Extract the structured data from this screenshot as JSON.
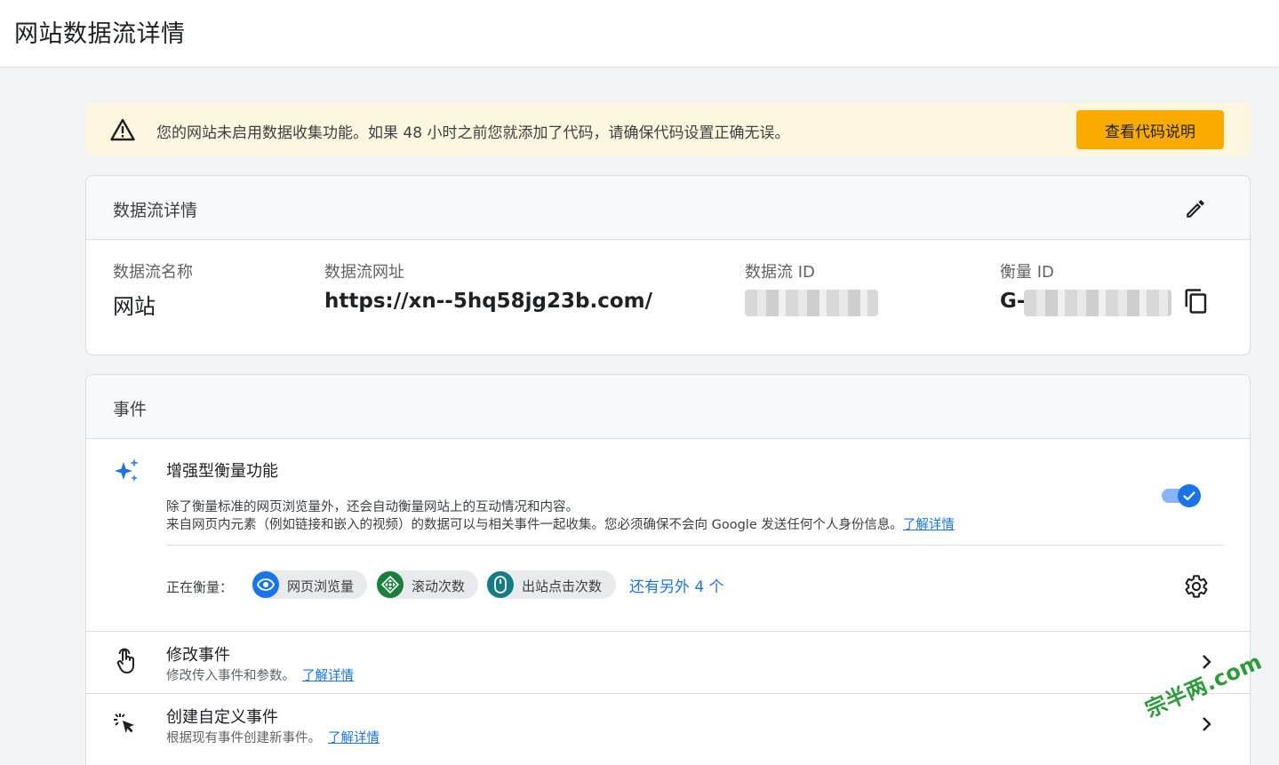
{
  "page": {
    "title": "网站数据流详情"
  },
  "alert": {
    "icon": "warning-triangle-icon",
    "message": "您的网站未启用数据收集功能。如果 48 小时之前您就添加了代码，请确保代码设置正确无误。",
    "button_label": "查看代码说明",
    "colors": {
      "background": "#fef7e0",
      "button": "#f9ab00"
    }
  },
  "stream_details": {
    "header": "数据流详情",
    "edit_icon": "pencil-icon",
    "fields": {
      "name_label": "数据流名称",
      "name_value": "网站",
      "url_label": "数据流网址",
      "url_value": "https://xn--5hq58jg23b.com/",
      "stream_id_label": "数据流 ID",
      "measurement_id_label": "衡量 ID",
      "measurement_id_prefix": "G-"
    },
    "copy_icon": "copy-icon"
  },
  "events": {
    "header": "事件",
    "enhanced": {
      "icon": "sparkle-icon",
      "title": "增强型衡量功能",
      "desc_line1": "除了衡量标准的网页浏览量外，还会自动衡量网站上的互动情况和内容。",
      "desc_line2": "来自网页内元素（例如链接和嵌入的视频）的数据可以与相关事件一起收集。您必须确保不会向 Google 发送任何个人身份信息。",
      "learn_more": "了解详情",
      "toggle_on": true,
      "measuring_label": "正在衡量：",
      "chips": [
        {
          "label": "网页浏览量",
          "icon": "eye-icon",
          "color": "#1a73e8"
        },
        {
          "label": "滚动次数",
          "icon": "scroll-diamond-icon",
          "color": "#188038"
        },
        {
          "label": "出站点击次数",
          "icon": "mouse-icon",
          "color": "#137c85"
        }
      ],
      "more_link": "还有另外 4 个",
      "settings_icon": "gear-icon"
    },
    "rows": [
      {
        "title": "修改事件",
        "desc": "修改传入事件和参数。",
        "learn_more": "了解详情",
        "icon": "touch-hand-icon",
        "chevron": "chevron-right-icon"
      },
      {
        "title": "创建自定义事件",
        "desc": "根据现有事件创建新事件。",
        "learn_more": "了解详情",
        "icon": "click-cursor-icon",
        "chevron": "chevron-right-icon"
      }
    ]
  },
  "watermark": "宗半两.com",
  "colors": {
    "accent": "#1a73e8",
    "page_bg": "#f1f3f4"
  }
}
